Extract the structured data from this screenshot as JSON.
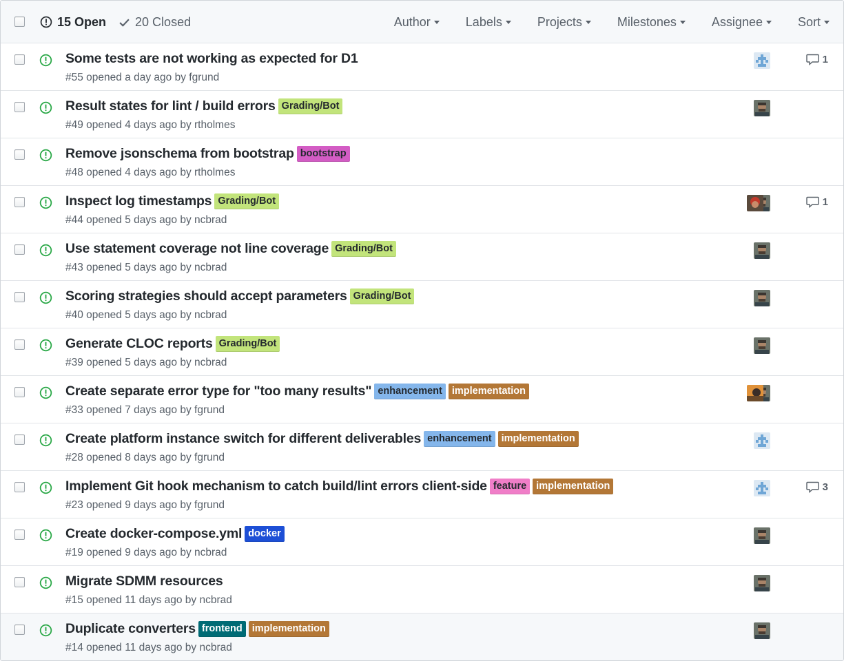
{
  "header": {
    "open_label": "15 Open",
    "closed_label": "20 Closed",
    "filters": [
      "Author",
      "Labels",
      "Projects",
      "Milestones",
      "Assignee",
      "Sort"
    ]
  },
  "colors": {
    "open_green": "#28a745",
    "grading_bot": "#c2e47b",
    "bootstrap": "#d35cc4",
    "enhancement": "#84b6eb",
    "implementation": "#b37736",
    "feature": "#f07ec8",
    "docker": "#1d4fd6",
    "frontend": "#006b75"
  },
  "issues": [
    {
      "title": "Some tests are not working as expected for D1",
      "meta": "#55 opened a day ago by fgrund",
      "labels": [],
      "assignee": "fgrund-avatar",
      "comments": "1"
    },
    {
      "title": "Result states for lint / build errors",
      "meta": "#49 opened 4 days ago by rtholmes",
      "labels": [
        {
          "text": "Grading/Bot",
          "bg": "#c2e47b",
          "fg": "#24292e"
        }
      ],
      "assignee": "ncbrad-avatar",
      "comments": ""
    },
    {
      "title": "Remove jsonschema from bootstrap",
      "meta": "#48 opened 4 days ago by rtholmes",
      "labels": [
        {
          "text": "bootstrap",
          "bg": "#d35cc4",
          "fg": "#24292e"
        }
      ],
      "assignee": "",
      "comments": ""
    },
    {
      "title": "Inspect log timestamps",
      "meta": "#44 opened 5 days ago by ncbrad",
      "labels": [
        {
          "text": "Grading/Bot",
          "bg": "#c2e47b",
          "fg": "#24292e"
        }
      ],
      "assignee": "multi-red",
      "comments": "1"
    },
    {
      "title": "Use statement coverage not line coverage",
      "meta": "#43 opened 5 days ago by ncbrad",
      "labels": [
        {
          "text": "Grading/Bot",
          "bg": "#c2e47b",
          "fg": "#24292e"
        }
      ],
      "assignee": "ncbrad-avatar",
      "comments": ""
    },
    {
      "title": "Scoring strategies should accept parameters",
      "meta": "#40 opened 5 days ago by ncbrad",
      "labels": [
        {
          "text": "Grading/Bot",
          "bg": "#c2e47b",
          "fg": "#24292e"
        }
      ],
      "assignee": "ncbrad-avatar",
      "comments": ""
    },
    {
      "title": "Generate CLOC reports",
      "meta": "#39 opened 5 days ago by ncbrad",
      "labels": [
        {
          "text": "Grading/Bot",
          "bg": "#c2e47b",
          "fg": "#24292e"
        }
      ],
      "assignee": "ncbrad-avatar",
      "comments": ""
    },
    {
      "title": "Create separate error type for \"too many results\"",
      "meta": "#33 opened 7 days ago by fgrund",
      "labels": [
        {
          "text": "enhancement",
          "bg": "#84b6eb",
          "fg": "#24292e"
        },
        {
          "text": "implementation",
          "bg": "#b37736",
          "fg": "#ffffff"
        }
      ],
      "assignee": "multi-orange",
      "comments": ""
    },
    {
      "title": "Create platform instance switch for different deliverables",
      "meta": "#28 opened 8 days ago by fgrund",
      "labels": [
        {
          "text": "enhancement",
          "bg": "#84b6eb",
          "fg": "#24292e"
        },
        {
          "text": "implementation",
          "bg": "#b37736",
          "fg": "#ffffff"
        }
      ],
      "assignee": "fgrund-avatar",
      "comments": ""
    },
    {
      "title": "Implement Git hook mechanism to catch build/lint errors client-side",
      "meta": "#23 opened 9 days ago by fgrund",
      "labels": [
        {
          "text": "feature",
          "bg": "#f07ec8",
          "fg": "#24292e"
        },
        {
          "text": "implementation",
          "bg": "#b37736",
          "fg": "#ffffff"
        }
      ],
      "assignee": "fgrund-avatar",
      "comments": "3"
    },
    {
      "title": "Create docker-compose.yml",
      "meta": "#19 opened 9 days ago by ncbrad",
      "labels": [
        {
          "text": "docker",
          "bg": "#1d4fd6",
          "fg": "#ffffff"
        }
      ],
      "assignee": "ncbrad-avatar",
      "comments": ""
    },
    {
      "title": "Migrate SDMM resources",
      "meta": "#15 opened 11 days ago by ncbrad",
      "labels": [],
      "assignee": "ncbrad-avatar",
      "comments": ""
    },
    {
      "title": "Duplicate converters",
      "meta": "#14 opened 11 days ago by ncbrad",
      "labels": [
        {
          "text": "frontend",
          "bg": "#006b75",
          "fg": "#ffffff"
        },
        {
          "text": "implementation",
          "bg": "#b37736",
          "fg": "#ffffff"
        }
      ],
      "assignee": "ncbrad-avatar",
      "comments": ""
    }
  ]
}
